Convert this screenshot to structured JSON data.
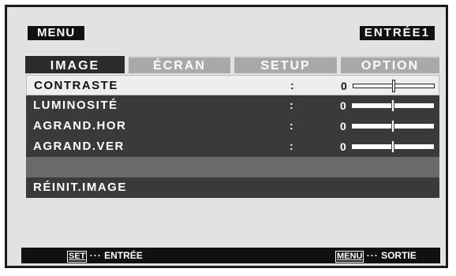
{
  "header": {
    "menu_label": "MENU",
    "input_label": "ENTRÉE1"
  },
  "tabs": [
    {
      "label": "IMAGE",
      "active": true
    },
    {
      "label": "ÉCRAN",
      "active": false
    },
    {
      "label": "SETUP",
      "active": false
    },
    {
      "label": "OPTION",
      "active": false
    }
  ],
  "rows": [
    {
      "label": "CONTRASTE",
      "sep": ":",
      "value": "0",
      "level": 0.5,
      "selected": true
    },
    {
      "label": "LUMINOSITÉ",
      "sep": ":",
      "value": "0",
      "level": 0.5,
      "selected": false
    },
    {
      "label": "AGRAND.HOR",
      "sep": ":",
      "value": "0",
      "level": 0.5,
      "selected": false
    },
    {
      "label": "AGRAND.VER",
      "sep": ":",
      "value": "0",
      "level": 0.5,
      "selected": false
    }
  ],
  "reset": {
    "label": "RÉINIT.IMAGE"
  },
  "footer": {
    "left_key": "SET",
    "left_dots": "···",
    "left_text": "ENTRÉE",
    "right_key": "MENU",
    "right_dots": "···",
    "right_text": "SORTIE"
  },
  "colors": {
    "background": "#e2e2e2",
    "bar": "#111111",
    "row": "#3a3a3a",
    "tab_inactive": "#a9a9a9"
  }
}
